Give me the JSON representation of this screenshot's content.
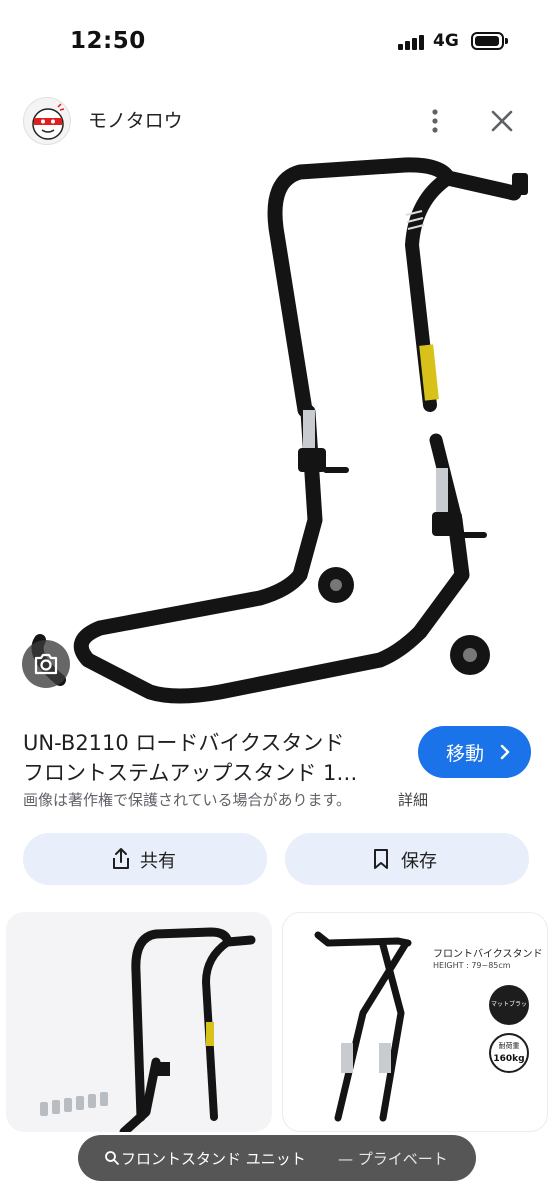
{
  "status_bar": {
    "time": "12:50",
    "network": "4G"
  },
  "header": {
    "site_name": "モノタロウ",
    "more_icon": "more-vert-icon",
    "close_icon": "close-icon"
  },
  "result": {
    "title_line1": "UN-B2110 ロードバイクスタンド",
    "title_line2": "フロントステムアップスタンド 1…",
    "visit_label": "移動",
    "copyright_notice": "画像は著作権で保護されている場合があります。",
    "details_label": "詳細"
  },
  "actions": {
    "share_label": "共有",
    "save_label": "保存"
  },
  "related": {
    "card2_title": "フロントバイクスタンド",
    "card2_subtitle": "HEIGHT : 79~85cm",
    "card2_badge_color": "マットブラック",
    "card2_load_label": "耐荷重",
    "card2_load_value": "160kg"
  },
  "search_bar": {
    "query": "フロントスタンド ユニット",
    "mode_label": "— プライベート"
  },
  "colors": {
    "accent": "#1a73e8",
    "action_bg": "#e8eefa",
    "stand_black": "#141414",
    "label_yellow": "#d8c21a"
  }
}
